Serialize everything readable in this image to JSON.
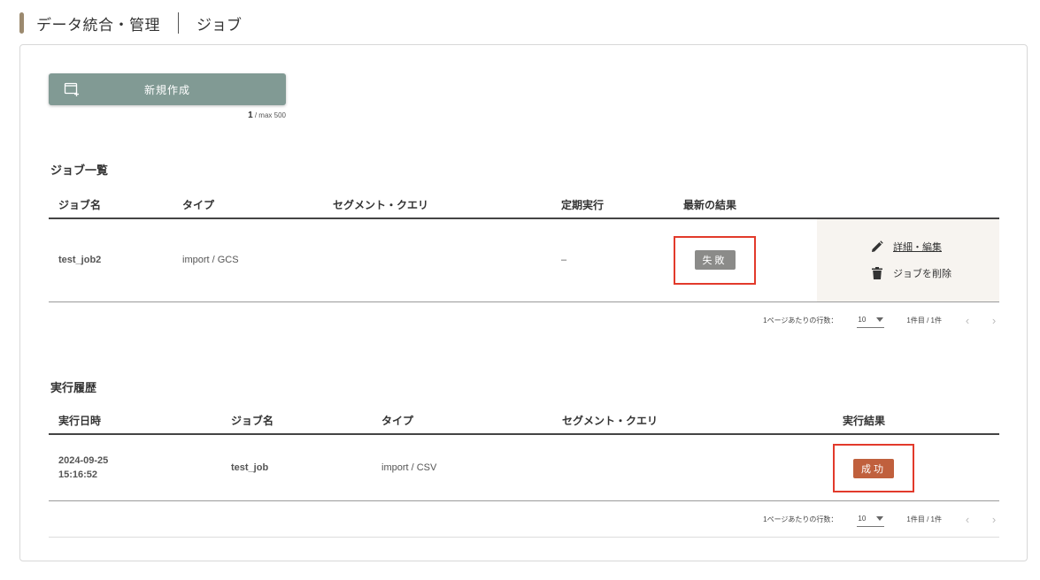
{
  "header": {
    "title": "データ統合・管理",
    "subtitle": "ジョブ"
  },
  "toolbar": {
    "new_label": "新規作成",
    "quota_count": "1",
    "quota_max": "/ max 500"
  },
  "jobs": {
    "title": "ジョブ一覧",
    "columns": [
      "ジョブ名",
      "タイプ",
      "セグメント・クエリ",
      "定期実行",
      "最新の結果"
    ],
    "rows": [
      {
        "name": "test_job2",
        "type": "import / GCS",
        "segment": "",
        "schedule": "–",
        "result": "失敗",
        "edit_label": "詳細・編集",
        "delete_label": "ジョブを削除"
      }
    ],
    "pager": {
      "rows_per_page_label": "1ページあたりの行数：",
      "rows_per_page": "10",
      "range": "1件目 / 1件"
    }
  },
  "history": {
    "title": "実行履歴",
    "columns": [
      "実行日時",
      "ジョブ名",
      "タイプ",
      "セグメント・クエリ",
      "実行結果"
    ],
    "rows": [
      {
        "date": "2024-09-25",
        "time": "15:16:52",
        "job_name": "test_job",
        "type": "import / CSV",
        "segment": "",
        "result": "成功"
      }
    ],
    "pager": {
      "rows_per_page_label": "1ページあたりの行数：",
      "rows_per_page": "10",
      "range": "1件目 / 1件"
    }
  },
  "colors": {
    "accent": "#9c8a6f",
    "primary_button": "#819a94",
    "fail": "#8b8b89",
    "success": "#c0603d",
    "highlight": "#e23a2b"
  }
}
